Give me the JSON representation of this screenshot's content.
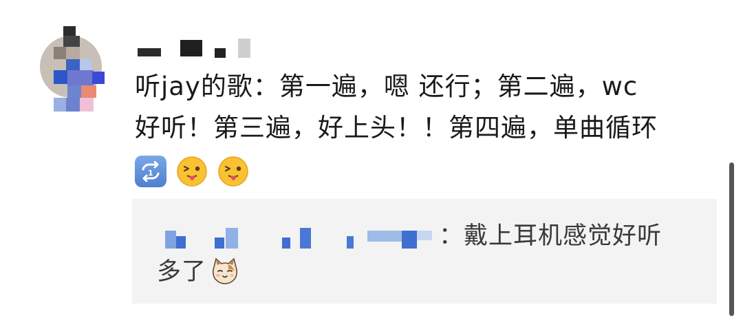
{
  "comment": {
    "username": "",
    "text_line1": "听jay的歌：第一遍，嗯 还行；第二遍，wc",
    "text_line2": "好听！第三遍，好上头！！第四遍，单曲循环",
    "emojis": [
      "repeat-icon",
      "tongue-out-face-icon",
      "tongue-out-face-icon"
    ]
  },
  "reply": {
    "username": "",
    "text": "：戴上耳机感觉好听",
    "text_line2": "多了",
    "emoji": "cat-face-icon"
  },
  "colors": {
    "text": "#1a1a1a",
    "reply_bg": "#f3f3f3",
    "reply_name_blur": "#6f97d8"
  }
}
